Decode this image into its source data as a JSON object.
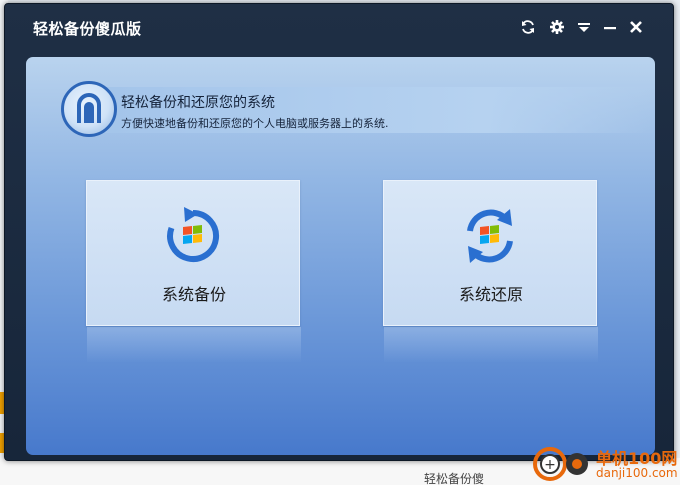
{
  "window": {
    "title": "轻松备份傻瓜版",
    "controls": [
      "refresh-icon",
      "gear-icon",
      "menu-icon",
      "minimize-icon",
      "close-icon"
    ]
  },
  "header": {
    "title": "轻松备份和还原您的系统",
    "subtitle": "方便快速地备份和还原您的个人电脑或服务器上的系统."
  },
  "actions": {
    "backup_label": "系统备份",
    "restore_label": "系统还原"
  },
  "background": {
    "bottom_text": "轻松备份傻"
  },
  "watermark": {
    "line1": "单机100网",
    "line2": "danji100.com"
  },
  "colors": {
    "titlebar": "#1f2f45",
    "panel_top": "#b9d3ee",
    "panel_bottom": "#4779cc",
    "accent_blue": "#2a6fd0",
    "watermark_orange": "#e8690c"
  }
}
